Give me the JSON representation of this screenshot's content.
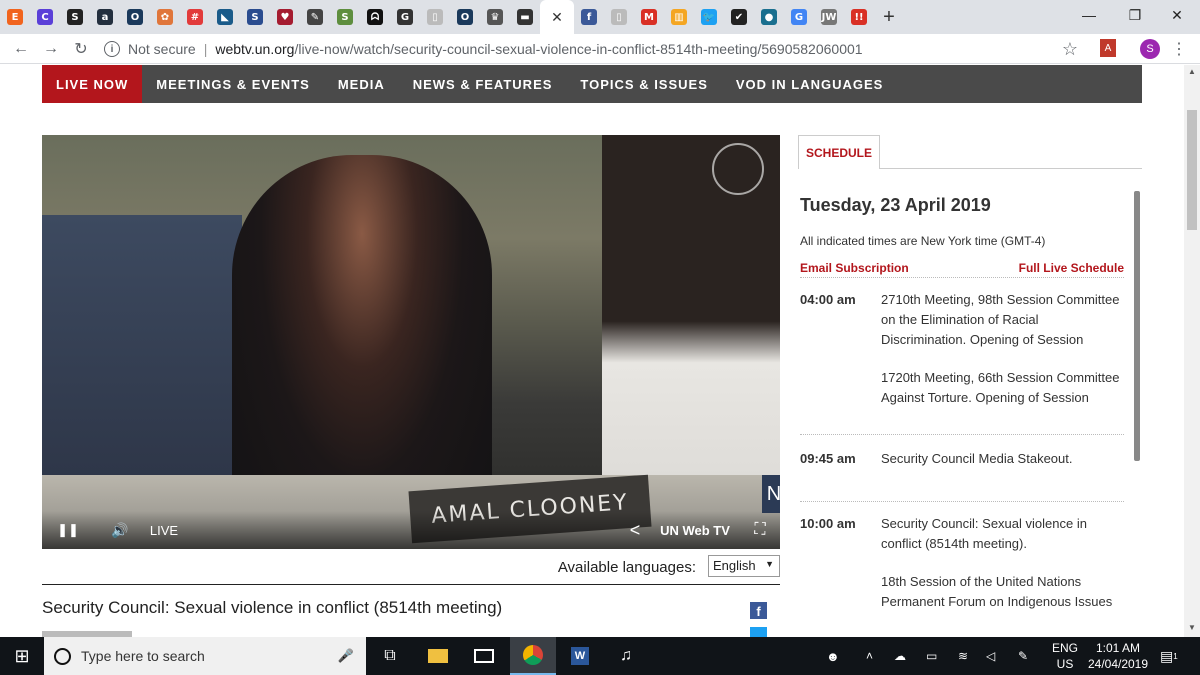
{
  "browser": {
    "tabs": [
      {
        "icon": "etsy-icon",
        "glyph": "E",
        "color": "#f1641e"
      },
      {
        "icon": "tab-icon",
        "glyph": "C",
        "color": "#5a3fd8"
      },
      {
        "icon": "tab-icon",
        "glyph": "S",
        "color": "#222222"
      },
      {
        "icon": "amazon-icon",
        "glyph": "a",
        "color": "#232f3e"
      },
      {
        "icon": "tab-icon",
        "glyph": "O",
        "color": "#1b3a5c"
      },
      {
        "icon": "tab-icon",
        "glyph": "✿",
        "color": "#e0763b"
      },
      {
        "icon": "tab-icon",
        "glyph": "#",
        "color": "#e23b3b"
      },
      {
        "icon": "tab-icon",
        "glyph": "◣",
        "color": "#1a5b8a"
      },
      {
        "icon": "tab-icon",
        "glyph": "S",
        "color": "#2a4c8f"
      },
      {
        "icon": "tab-icon",
        "glyph": "♥",
        "color": "#a51c30"
      },
      {
        "icon": "pin-icon",
        "glyph": "✎",
        "color": "#444444"
      },
      {
        "icon": "shopify-icon",
        "glyph": "S",
        "color": "#5e8e3e"
      },
      {
        "icon": "abc-icon",
        "glyph": "ᗣ",
        "color": "#111111"
      },
      {
        "icon": "tab-icon",
        "glyph": "G",
        "color": "#333333"
      },
      {
        "icon": "doc-icon",
        "glyph": "▯",
        "color": "#bbbbbb"
      },
      {
        "icon": "tab-icon",
        "glyph": "O",
        "color": "#1b3a5c"
      },
      {
        "icon": "crown-icon",
        "glyph": "♛",
        "color": "#555555"
      },
      {
        "icon": "tab-icon",
        "glyph": "▬",
        "color": "#333333"
      }
    ],
    "active_tab": {
      "glyph": "·",
      "close": "✕"
    },
    "tabs_after": [
      {
        "icon": "facebook-icon",
        "glyph": "f",
        "color": "#3b5998"
      },
      {
        "icon": "doc-icon",
        "glyph": "▯",
        "color": "#bbbbbb"
      },
      {
        "icon": "gmail-icon",
        "glyph": "M",
        "color": "#d93025"
      },
      {
        "icon": "tab-icon",
        "glyph": "▥",
        "color": "#f4a623"
      },
      {
        "icon": "twitter-icon",
        "glyph": "🐦",
        "color": "#1da1f2"
      },
      {
        "icon": "tab-icon",
        "glyph": "✔",
        "color": "#222222"
      },
      {
        "icon": "tab-icon",
        "glyph": "●",
        "color": "#1a6f8f"
      },
      {
        "icon": "google-icon",
        "glyph": "G",
        "color": "#4285f4"
      },
      {
        "icon": "tab-icon",
        "glyph": "JW",
        "color": "#777777"
      },
      {
        "icon": "tab-icon",
        "glyph": "!!",
        "color": "#d93025"
      }
    ],
    "new_tab": "+",
    "window_controls": {
      "minimize": "—",
      "maximize": "❐",
      "close": "✕"
    },
    "back": "←",
    "forward": "→",
    "reload": "↻",
    "not_secure": "Not secure",
    "url_host": "webtv.un.org",
    "url_path": "/live-now/watch/security-council-sexual-violence-in-conflict-8514th-meeting/5690582060001",
    "star": "☆",
    "profile_initial": "S",
    "menu": "⋮"
  },
  "nav": {
    "items": [
      "LIVE NOW",
      "MEETINGS & EVENTS",
      "MEDIA",
      "NEWS & FEATURES",
      "TOPICS & ISSUES",
      "VOD IN LANGUAGES"
    ]
  },
  "player": {
    "nameplate": "AMAL CLOONEY",
    "nameplate_edge": "N",
    "live_label": "LIVE",
    "brand": "UN Web TV",
    "play_icon": "❚❚",
    "volume_icon": "🔊",
    "share_icon": "<",
    "fullscreen_icon": "⛶"
  },
  "languages": {
    "label": "Available languages:",
    "selected": "English",
    "caret": "▼"
  },
  "video_title": "Security Council: Sexual violence in conflict (8514th meeting)",
  "social": {
    "facebook": "f"
  },
  "schedule": {
    "tab": "SCHEDULE",
    "date": "Tuesday, 23 April 2019",
    "timezone_note": "All indicated times are New York time (GMT-4)",
    "email_link": "Email Subscription",
    "full_link": "Full Live Schedule",
    "events": [
      {
        "time": "04:00 am",
        "items": [
          "2710th Meeting, 98th Session Committee on the Elimination of Racial Discrimination. Opening of Session",
          "1720th Meeting, 66th Session Committee Against Torture. Opening of Session"
        ]
      },
      {
        "time": "09:45 am",
        "items": [
          "Security Council Media Stakeout."
        ]
      },
      {
        "time": "10:00 am",
        "items": [
          "Security Council: Sexual violence in conflict (8514th meeting).",
          "18th Session of the United Nations Permanent Forum on Indigenous Issues"
        ]
      }
    ]
  },
  "taskbar": {
    "start_icon": "⊞",
    "search_placeholder": "Type here to search",
    "mic_icon": "🎤",
    "lang": "ENG",
    "region": "US",
    "time": "1:01 AM",
    "date": "24/04/2019",
    "notification_count": "1"
  }
}
